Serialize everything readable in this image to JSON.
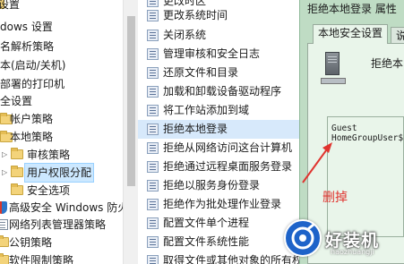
{
  "tree": {
    "items": [
      {
        "label": "设置",
        "icon": "folder"
      },
      {
        "label": "dows 设置",
        "icon": "folder"
      },
      {
        "label": "名解析策略",
        "icon": "list"
      },
      {
        "label": "本(启动/关机)",
        "icon": "list"
      },
      {
        "label": "部署的打印机",
        "icon": "folder"
      },
      {
        "label": "全设置",
        "icon": "folder"
      },
      {
        "label": "帐户策略",
        "icon": "folder"
      },
      {
        "label": "本地策略",
        "icon": "folder"
      },
      {
        "label": "审核策略",
        "icon": "folder"
      },
      {
        "label": "用户权限分配",
        "icon": "folder"
      },
      {
        "label": "安全选项",
        "icon": "folder"
      },
      {
        "label": "高级安全 Windows 防火",
        "icon": "shield"
      },
      {
        "label": "网络列表管理器策略",
        "icon": "list"
      },
      {
        "label": "公钥策略",
        "icon": "folder"
      },
      {
        "label": "软件限制策略",
        "icon": "folder"
      }
    ]
  },
  "policies": {
    "items": [
      "更改时区",
      "更改系统时间",
      "关闭系统",
      "管理审核和安全日志",
      "还原文件和目录",
      "加载和卸载设备驱动程序",
      "将工作站添加到域",
      "拒绝本地登录",
      "拒绝从网络访问这台计算机",
      "拒绝通过远程桌面服务登录",
      "拒绝以服务身份登录",
      "拒绝作为批处理作业登录",
      "配置文件单个进程",
      "配置文件系统性能",
      "取得文件或其他对象的所有权"
    ],
    "selected_index": 7
  },
  "dialog": {
    "title": "拒绝本地登录 属性",
    "tabs": [
      "本地安全设置",
      "说"
    ],
    "heading": "拒绝本",
    "accounts": [
      "Guest",
      "HomeGroupUser$"
    ]
  },
  "annotation": {
    "text": "删掉",
    "color": "#e0342f"
  },
  "watermark": {
    "text": "好装机",
    "subtext": "haozhuangji"
  },
  "colors": {
    "dialog_bg": "#bfdcc4",
    "selection": "#cce8ff"
  }
}
